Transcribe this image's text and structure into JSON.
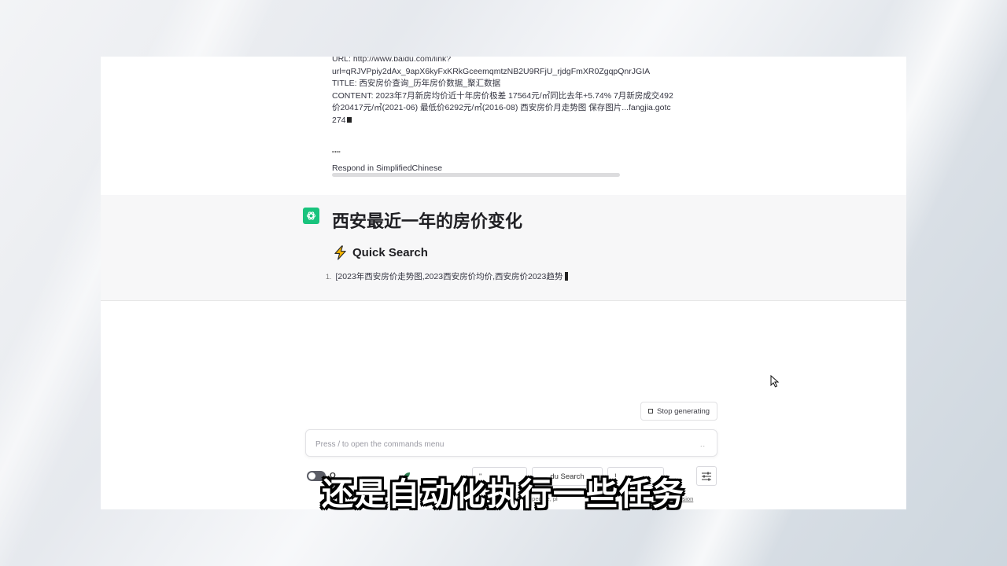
{
  "user_message": {
    "lines": [
      "URL: http://www.baidu.com/link?",
      "url=qRJVPpiy2dAx_9apX6kyFxKRkGceemqmtzNB2U9RFjU_rjdgFmXR0ZgqpQnrJGIA",
      "TITLE: 西安房价查询_历年房价数据_聚汇数据",
      "CONTENT: 2023年7月新房均价近十年房价极差 17564元/㎡同比去年+5.74% 7月新房成交492",
      "价20417元/㎡(2021-06) 最低价6292元/㎡(2016-08) 西安房价月走势图 保存图片...fangjia.gotc",
      "274"
    ],
    "ellipsis": "\"\"\"",
    "respond_in": "Respond in SimplifiedChinese"
  },
  "assistant": {
    "title": "西安最近一年的房价变化",
    "quick_search_label": "Quick Search",
    "results": [
      {
        "num": "1.",
        "text": "[2023年西安房价走势图,2023西安房价均价,西安房价2023趋势"
      }
    ]
  },
  "controls": {
    "stop_label": "Stop generating",
    "input_placeholder": "Press / to open the commands menu",
    "send_glyph": "..",
    "toggle_label": "O",
    "chips": [
      "\"",
      "du Search",
      "!"
    ],
    "footer_left": "F",
    "footer_mid": "t people, pl",
    "footer_link": "3 Version"
  },
  "subtitle": "还是自动化执行一些任务",
  "colors": {
    "brand": "#19c37d",
    "panel": "#f7f7f8",
    "bolt": "#f5b400"
  }
}
